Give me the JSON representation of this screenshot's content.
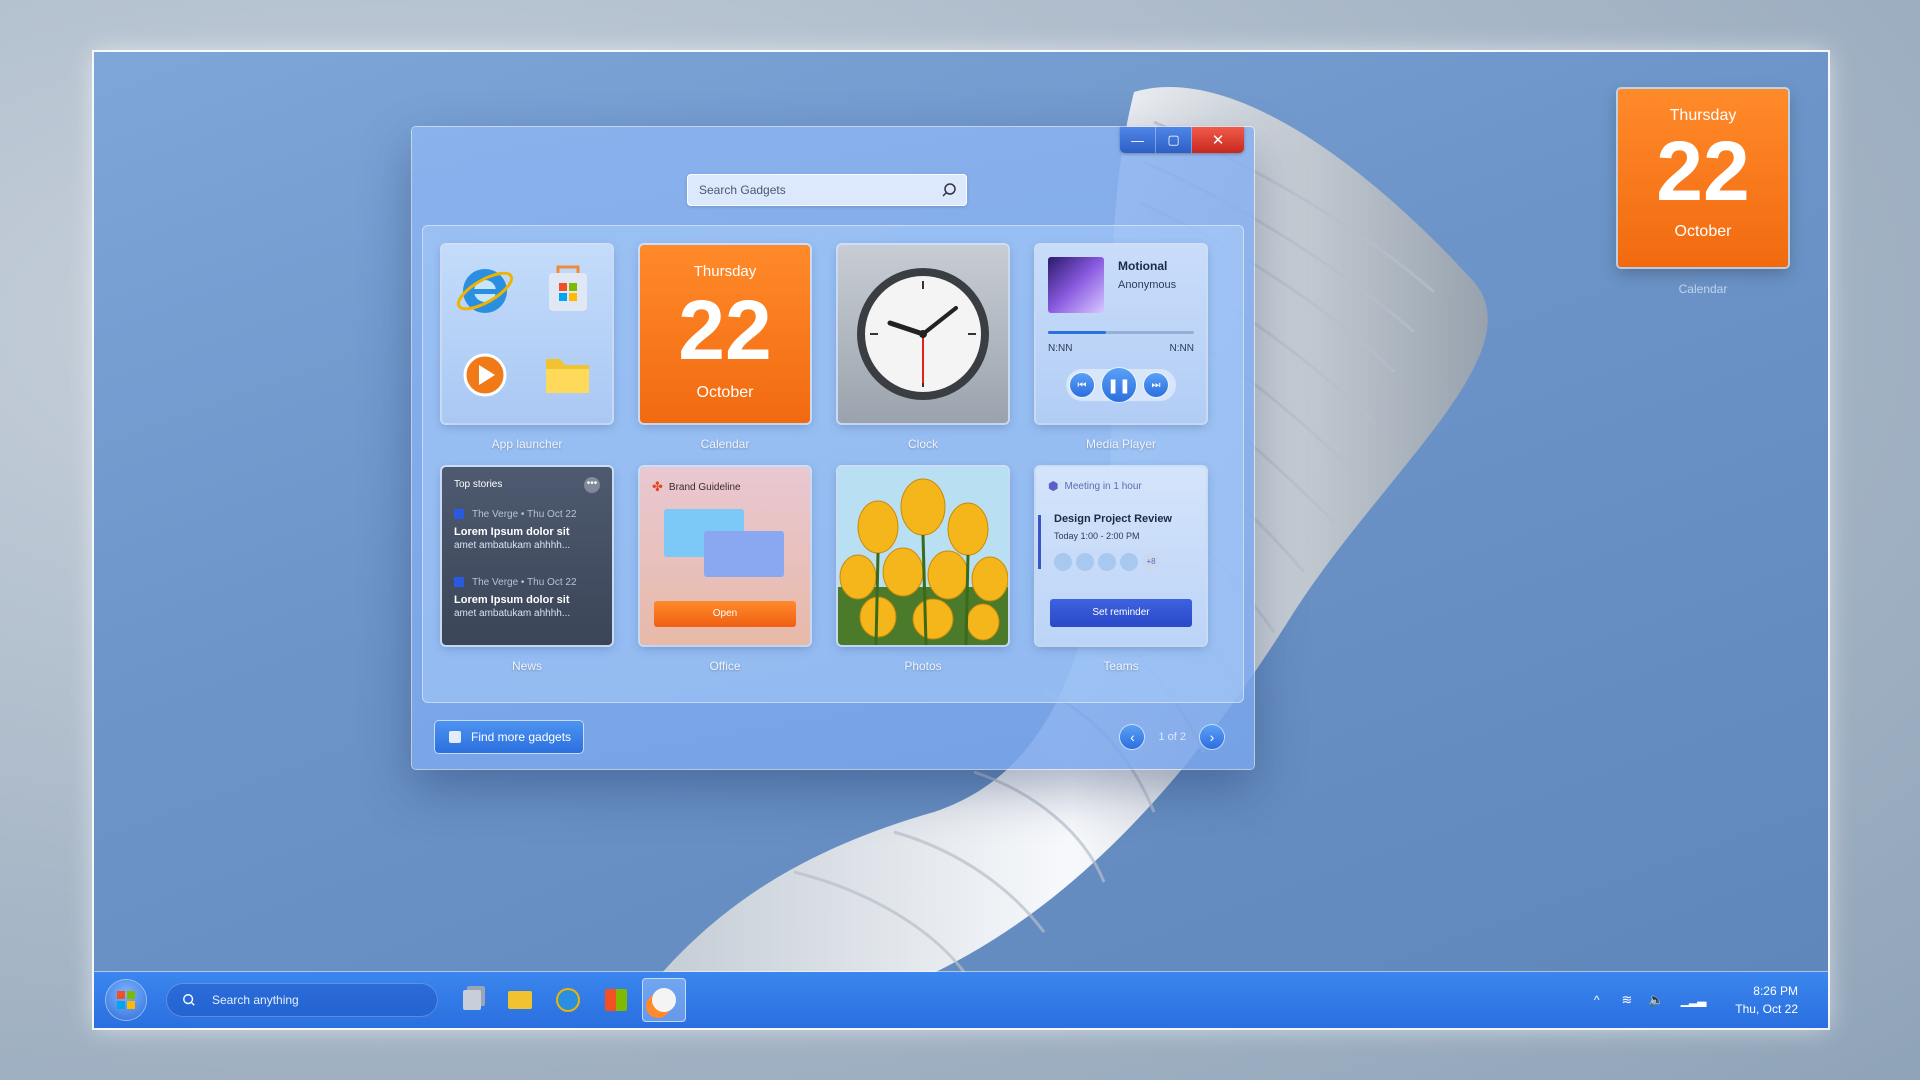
{
  "window": {
    "controls": {
      "minimize": "—",
      "maximize": "▢",
      "close": "✕"
    },
    "search_placeholder": "Search Gadgets"
  },
  "gadgets": [
    {
      "label": "App launcher"
    },
    {
      "label": "Calendar",
      "day": "Thursday",
      "date": "22",
      "month": "October"
    },
    {
      "label": "Clock"
    },
    {
      "label": "Media Player",
      "track": "Motional",
      "artist": "Anonymous",
      "elapsed": "N:NN",
      "duration": "N:NN",
      "progress_pct": 40
    },
    {
      "label": "News",
      "header": "Top stories",
      "items": [
        {
          "source": "The Verge",
          "date": "Thu Oct 22",
          "headline": "Lorem Ipsum dolor sit",
          "sub": "amet ambatukam ahhhh..."
        },
        {
          "source": "The Verge",
          "date": "Thu Oct 22",
          "headline": "Lorem Ipsum dolor sit",
          "sub": "amet ambatukam ahhhh..."
        }
      ]
    },
    {
      "label": "Office",
      "doc": "Brand Guideline",
      "button": "Open"
    },
    {
      "label": "Photos"
    },
    {
      "label": "Teams",
      "notice": "Meeting in 1 hour",
      "title": "Design Project Review",
      "time": "Today 1:00 - 2:00 PM",
      "extra": "+8",
      "button": "Set reminder"
    }
  ],
  "footer": {
    "find_button": "Find more gadgets",
    "page": "1 of 2"
  },
  "desktop_calendar": {
    "day": "Thursday",
    "date": "22",
    "month": "October",
    "label": "Calendar"
  },
  "taskbar": {
    "search_placeholder": "Search anything",
    "time": "8:26 PM",
    "date": "Thu, Oct 22"
  },
  "colors": {
    "accent": "#2b70df",
    "calendar": "#f26a10",
    "close": "#c8281e"
  }
}
